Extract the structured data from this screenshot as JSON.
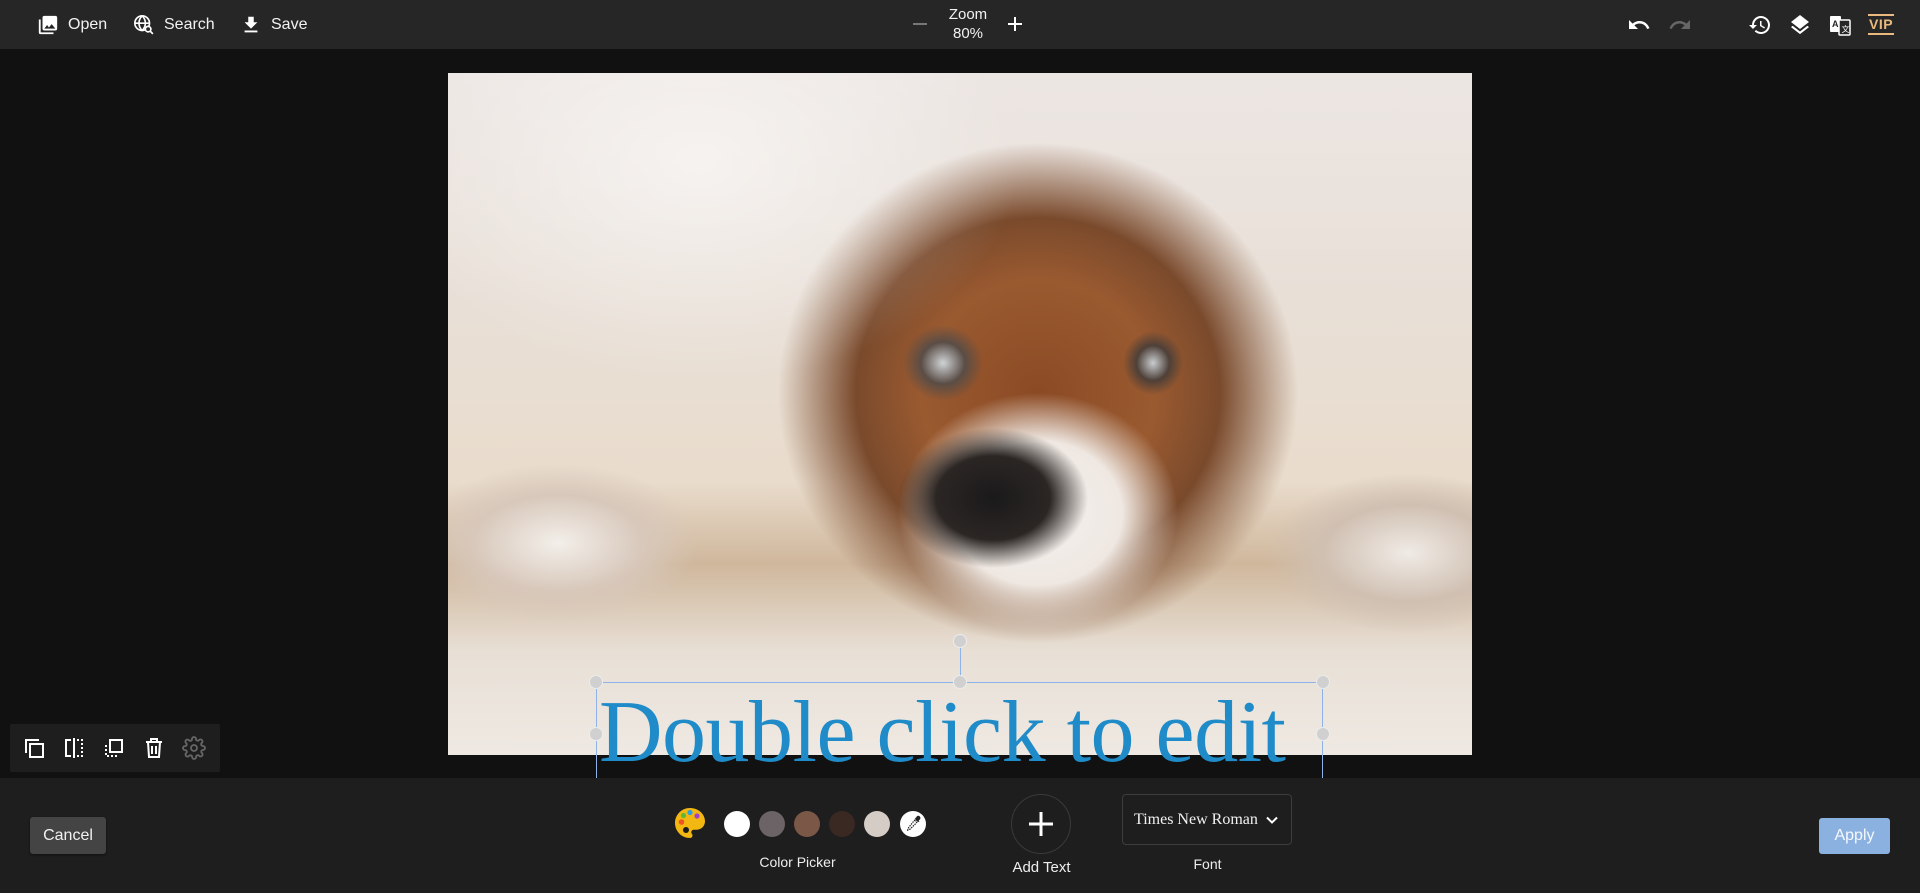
{
  "topbar": {
    "open_label": "Open",
    "search_label": "Search",
    "save_label": "Save",
    "zoom": {
      "title": "Zoom",
      "value": "80%"
    },
    "right_icons": [
      "undo-icon",
      "redo-icon",
      "history-icon",
      "layers-icon",
      "translate-icon",
      "vip-badge"
    ],
    "vip_label": "VIP",
    "vip_color": "#e9b97e"
  },
  "canvas": {
    "image_subject": "Brown and white spaniel puppy lying on carpet",
    "text_layer": {
      "text": "Double click to edit",
      "color": "#1f8bc8",
      "font": "Times New Roman",
      "selected": true
    }
  },
  "object_toolbar": {
    "items": [
      "duplicate-icon",
      "flip-horizontal-icon",
      "bring-to-front-icon",
      "delete-icon",
      "settings-icon"
    ]
  },
  "bottombar": {
    "cancel_label": "Cancel",
    "apply_label": "Apply",
    "apply_color": "#8bb1e0",
    "color_picker": {
      "label": "Color Picker",
      "swatches": [
        "#ffffff",
        "#6b6366",
        "#7b5748",
        "#3a2823",
        "#d6ccc6"
      ]
    },
    "add_text_label": "Add Text",
    "font": {
      "label": "Font",
      "value": "Times New Roman"
    }
  }
}
